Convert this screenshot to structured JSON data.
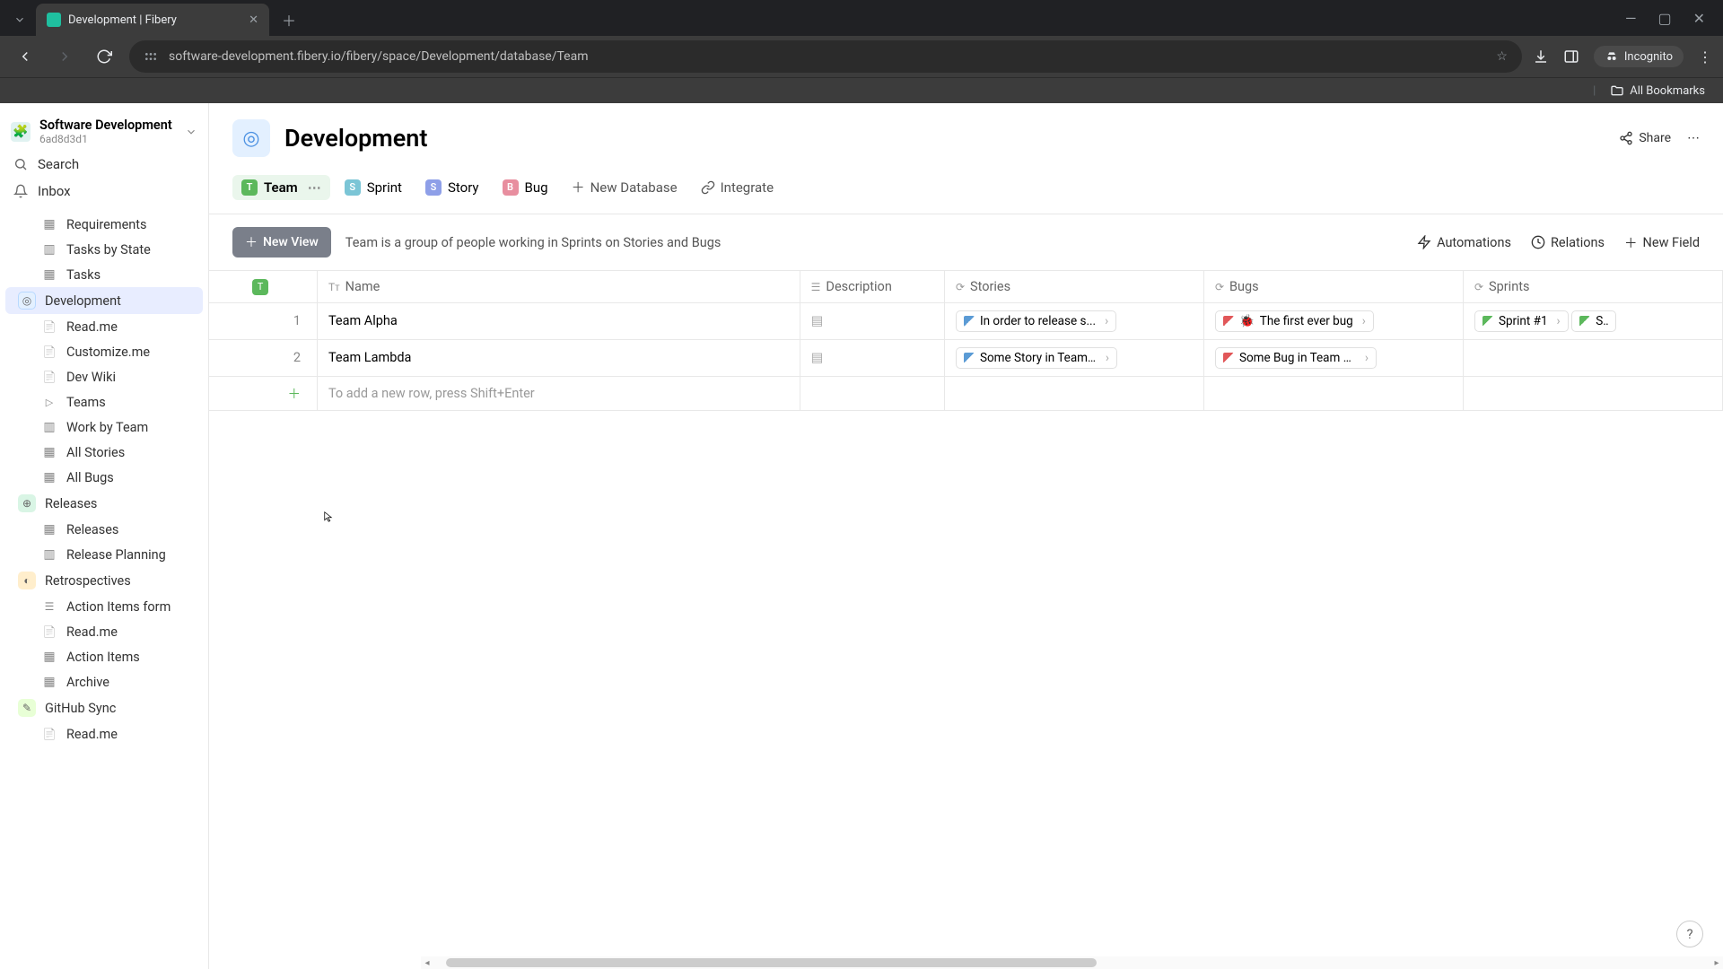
{
  "browser": {
    "tab_title": "Development | Fibery",
    "url": "software-development.fibery.io/fibery/space/Development/database/Team",
    "incognito_label": "Incognito",
    "all_bookmarks": "All Bookmarks"
  },
  "workspace": {
    "name": "Software Development",
    "subtitle": "6ad8d3d1"
  },
  "sidebar": {
    "search": "Search",
    "inbox": "Inbox",
    "items": [
      {
        "label": "Requirements",
        "icon": "grid"
      },
      {
        "label": "Tasks by State",
        "icon": "board"
      },
      {
        "label": "Tasks",
        "icon": "grid"
      }
    ],
    "dev_section": "Development",
    "dev_items": [
      {
        "label": "Read.me",
        "icon": "doc"
      },
      {
        "label": "Customize.me",
        "icon": "doc"
      },
      {
        "label": "Dev Wiki",
        "icon": "doc"
      },
      {
        "label": "Teams",
        "icon": "play"
      },
      {
        "label": "Work by Team",
        "icon": "board"
      },
      {
        "label": "All Stories",
        "icon": "grid"
      },
      {
        "label": "All Bugs",
        "icon": "grid"
      }
    ],
    "releases_section": "Releases",
    "releases_items": [
      {
        "label": "Releases",
        "icon": "grid"
      },
      {
        "label": "Release Planning",
        "icon": "board"
      }
    ],
    "retro_section": "Retrospectives",
    "retro_items": [
      {
        "label": "Action Items form",
        "icon": "form"
      },
      {
        "label": "Read.me",
        "icon": "doc"
      },
      {
        "label": "Action Items",
        "icon": "grid"
      },
      {
        "label": "Archive",
        "icon": "grid"
      }
    ],
    "github_section": "GitHub Sync",
    "github_items": [
      {
        "label": "Read.me",
        "icon": "doc"
      }
    ]
  },
  "header": {
    "title": "Development",
    "share": "Share"
  },
  "tabs": {
    "team": "Team",
    "sprint": "Sprint",
    "story": "Story",
    "bug": "Bug",
    "new_database": "New Database",
    "integrate": "Integrate"
  },
  "viewbar": {
    "new_view": "New View",
    "description": "Team is a group of people working in Sprints on Stories and Bugs",
    "automations": "Automations",
    "relations": "Relations",
    "new_field": "New Field"
  },
  "table": {
    "columns": {
      "name": "Name",
      "description": "Description",
      "stories": "Stories",
      "bugs": "Bugs",
      "sprints": "Sprints"
    },
    "rows": [
      {
        "num": "1",
        "name": "Team Alpha",
        "story": "In order to release s...",
        "bug": "The first ever bug",
        "bug_emoji": "🐞",
        "sprint": "Sprint #1",
        "sprint2": "Spr"
      },
      {
        "num": "2",
        "name": "Team Lambda",
        "story": "Some Story in Team ...",
        "bug": "Some Bug in Team L..."
      }
    ],
    "add_row_hint": "To add a new row, press Shift+Enter"
  }
}
